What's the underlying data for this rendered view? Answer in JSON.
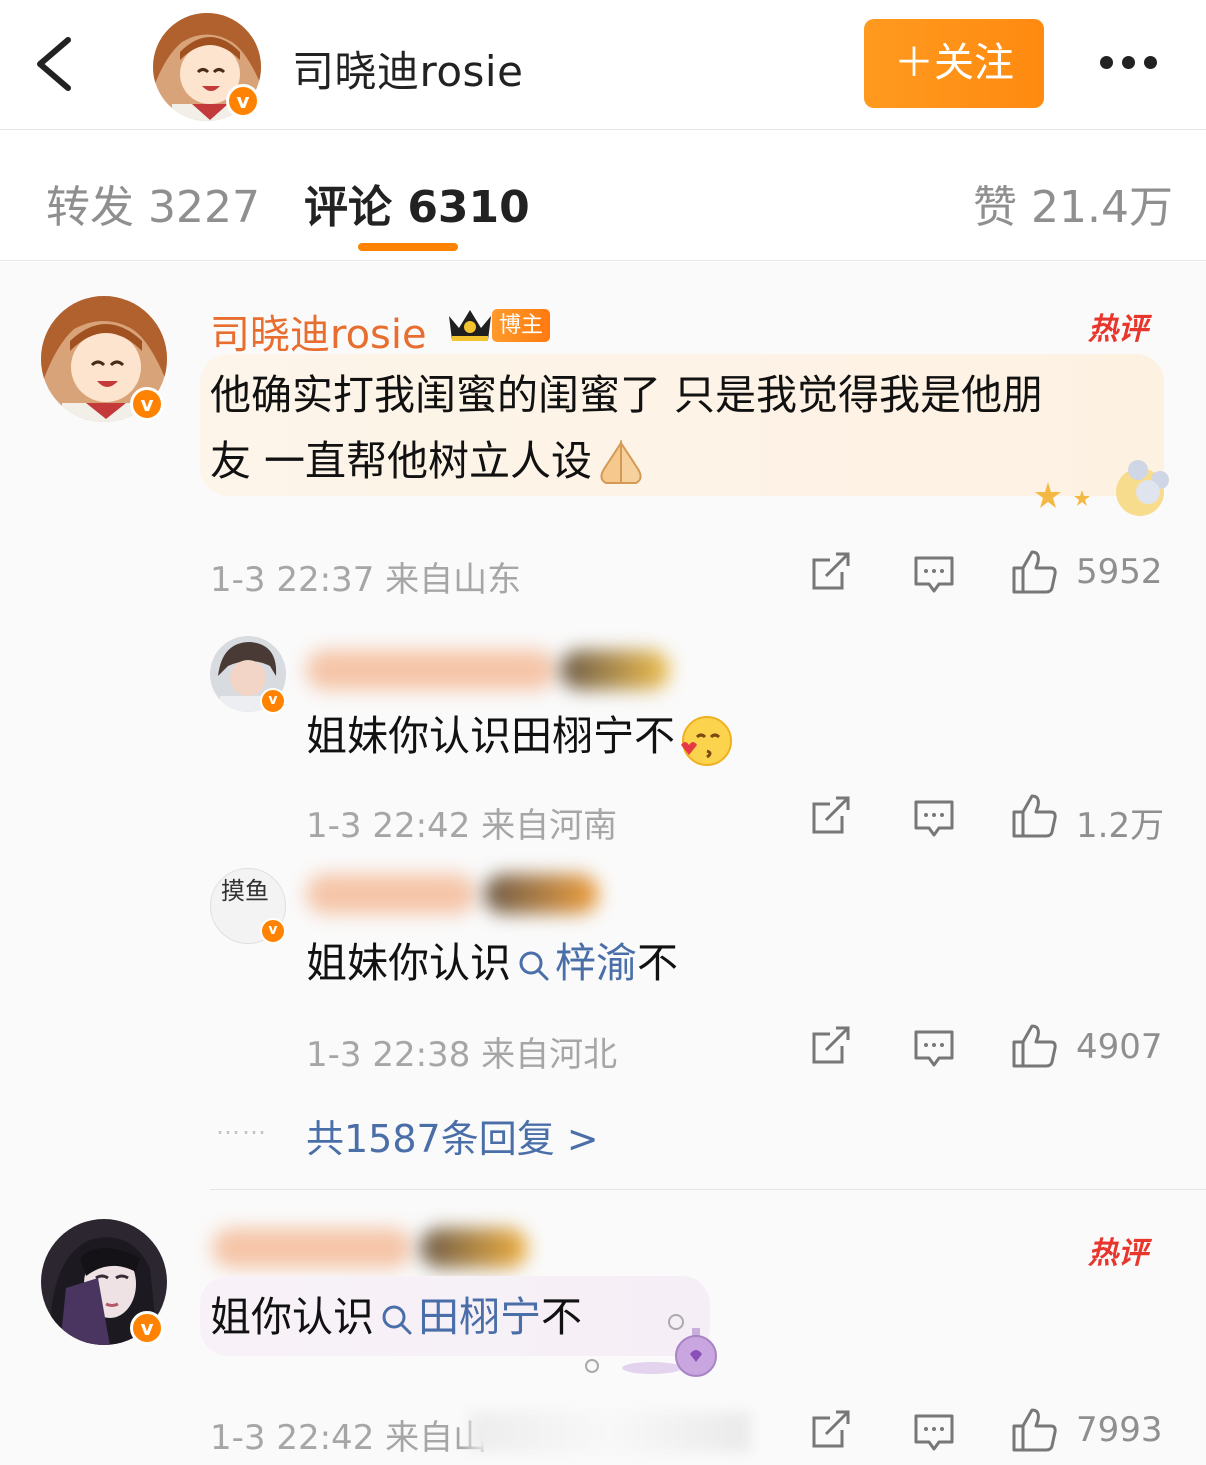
{
  "header": {
    "author": "司晓迪rosie",
    "follow_label": "＋关注",
    "verified_mark": "v"
  },
  "tabs": [
    {
      "label": "转发 3227"
    },
    {
      "label": "评论 6310"
    },
    {
      "label": "赞 21.4万"
    }
  ],
  "comments": [
    {
      "author": "司晓迪rosie",
      "role_badge": "博主",
      "hot_badge": "热评",
      "text_line1": "他确实打我闺蜜的闺蜜了 只是我觉得我是他朋",
      "text_line2": "友 一直帮他树立人设",
      "time_location": "1-3 22:37  来自山东",
      "likes": "5952",
      "replies": [
        {
          "text": "姐妹你认识田栩宁不",
          "time_location": "1-3 22:42  来自河南",
          "likes": "1.2万"
        },
        {
          "text_prefix": "姐妹你认识",
          "topic": "梓渝",
          "text_suffix": "不",
          "avatar_chars": "摸鱼",
          "time_location": "1-3 22:38  来自河北",
          "likes": "4907"
        }
      ],
      "more_dots": "……",
      "more_replies": "共1587条回复 >"
    },
    {
      "hot_badge": "热评",
      "text_prefix": "姐你认识",
      "topic": "田栩宁",
      "text_suffix": "不",
      "time_location": "1-3 22:42  来自山",
      "likes": "7993"
    }
  ],
  "colors": {
    "accent": "#ff8200",
    "author_name": "#e86e30",
    "link": "#4a6ea8",
    "hot": "#e8362d"
  },
  "icons": [
    "back-icon",
    "more-icon",
    "repost-icon",
    "comment-icon",
    "like-icon",
    "search-icon",
    "crown-icon"
  ]
}
